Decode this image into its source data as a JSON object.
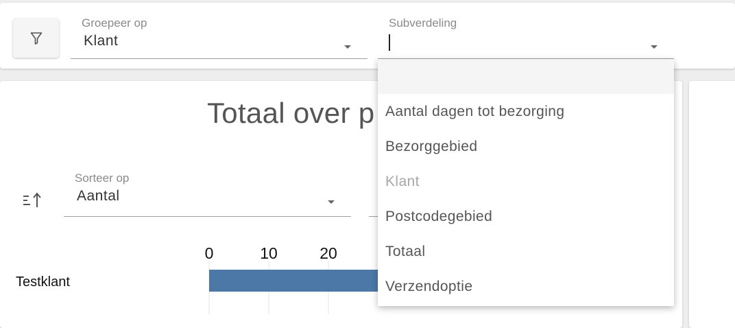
{
  "filters": {
    "group_by": {
      "label": "Groepeer op",
      "value": "Klant"
    },
    "subdivision": {
      "label": "Subverdeling",
      "value": ""
    }
  },
  "chart": {
    "title": "Totaal over p",
    "sort": {
      "label": "Sorteer op",
      "value": "Aantal"
    }
  },
  "chart_data": {
    "type": "bar",
    "categories": [
      "Testklant"
    ],
    "values": [
      29
    ],
    "x_ticks": [
      0,
      10,
      20
    ],
    "title": "Totaal over p",
    "bar_color": "#4c78a8"
  },
  "dropdown": {
    "options": [
      {
        "label": "",
        "state": "empty"
      },
      {
        "label": "Aantal dagen tot bezorging",
        "state": "normal"
      },
      {
        "label": "Bezorggebied",
        "state": "normal"
      },
      {
        "label": "Klant",
        "state": "disabled"
      },
      {
        "label": "Postcodegebied",
        "state": "normal"
      },
      {
        "label": "Totaal",
        "state": "normal"
      },
      {
        "label": "Verzendoptie",
        "state": "normal"
      }
    ]
  }
}
